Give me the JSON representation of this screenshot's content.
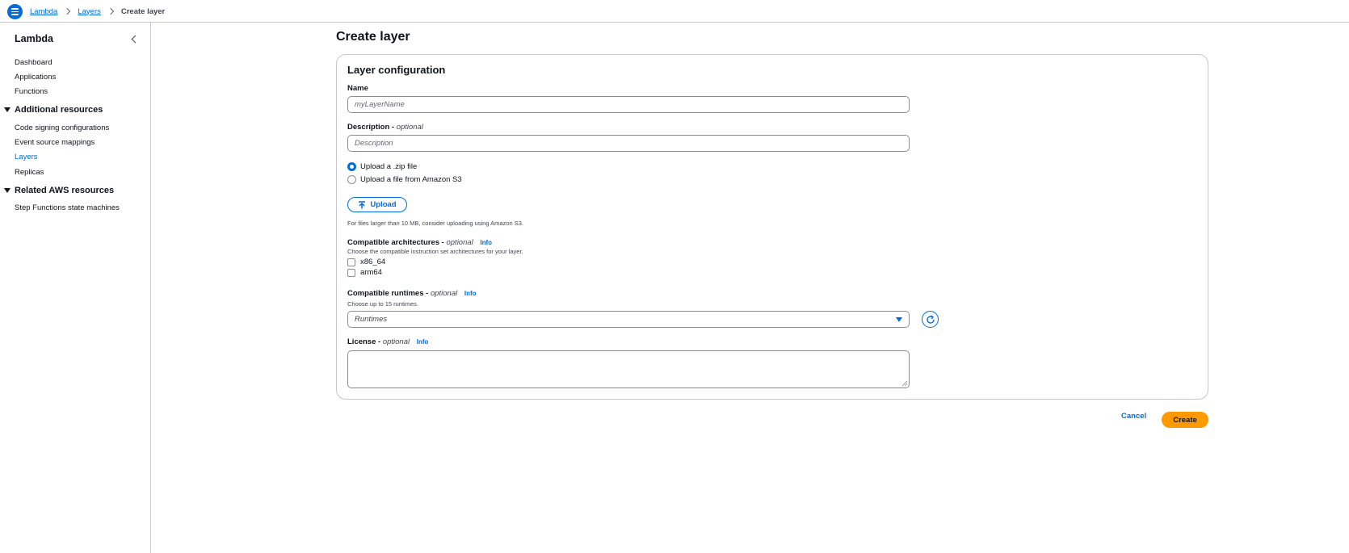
{
  "breadcrumb": {
    "items": [
      "Lambda",
      "Layers"
    ],
    "current": "Create layer"
  },
  "sidebar": {
    "title": "Lambda",
    "items": [
      "Dashboard",
      "Applications",
      "Functions"
    ],
    "sections": [
      {
        "title": "Additional resources",
        "items": [
          "Code signing configurations",
          "Event source mappings",
          "Layers",
          "Replicas"
        ],
        "active": "Layers"
      },
      {
        "title": "Related AWS resources",
        "items": [
          "Step Functions state machines"
        ]
      }
    ]
  },
  "page": {
    "title": "Create layer"
  },
  "form": {
    "panel_title": "Layer configuration",
    "name": {
      "label": "Name",
      "placeholder": "myLayerName"
    },
    "description": {
      "label": "Description -",
      "optional": "optional",
      "placeholder": "Description"
    },
    "upload_options": [
      "Upload a .zip file",
      "Upload a file from Amazon S3"
    ],
    "selected_upload_option": "Upload a .zip file",
    "upload_button": "Upload",
    "upload_hint": "For files larger than 10 MB, consider uploading using Amazon S3.",
    "architectures": {
      "label": "Compatible architectures -",
      "optional": "optional",
      "info": "Info",
      "hint": "Choose the compatible instruction set architectures for your layer.",
      "options": [
        "x86_64",
        "arm64"
      ]
    },
    "runtimes": {
      "label": "Compatible runtimes -",
      "optional": "optional",
      "info": "Info",
      "hint": "Choose up to 15 runtimes.",
      "placeholder": "Runtimes"
    },
    "license": {
      "label": "License -",
      "optional": "optional",
      "info": "Info"
    }
  },
  "actions": {
    "cancel": "Cancel",
    "create": "Create"
  },
  "colors": {
    "link": "#006ce0",
    "primary_button": "#ff9900",
    "border": "#c6c6cd"
  }
}
